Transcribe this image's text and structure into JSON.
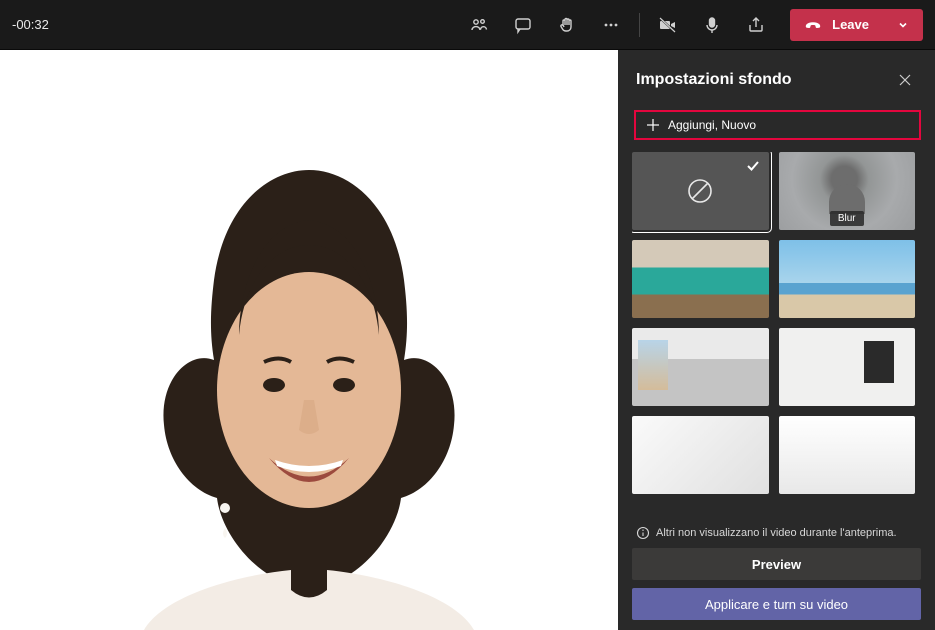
{
  "timer": "-00:32",
  "toolbar": {
    "leave_label": "Leave"
  },
  "sidebar": {
    "title": "Impostazioni sfondo",
    "add_label": "Aggiungi, Nuovo",
    "blur_label": "Blur",
    "info_text": "Altri non visualizzano il video durante l'anteprima.",
    "preview_label": "Preview",
    "apply_label": "Applicare e turn su video",
    "backgrounds": [
      {
        "id": "none",
        "selected": true
      },
      {
        "id": "blur"
      },
      {
        "id": "office-lockers"
      },
      {
        "id": "beach"
      },
      {
        "id": "loft-window"
      },
      {
        "id": "mirror-room"
      },
      {
        "id": "white-interior-1"
      },
      {
        "id": "white-interior-2"
      }
    ]
  }
}
